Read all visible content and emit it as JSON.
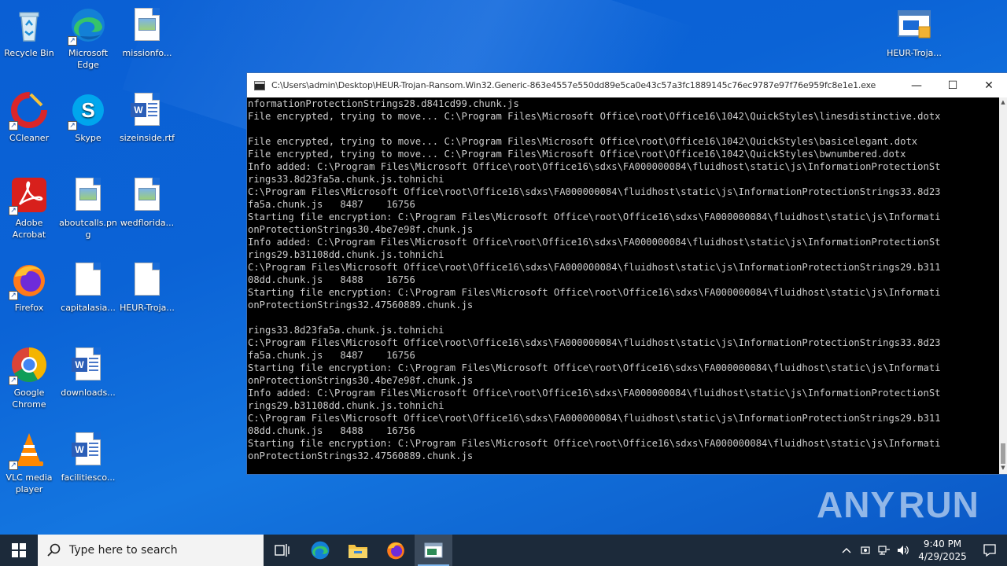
{
  "desktop": {
    "icons": [
      {
        "label": "Recycle Bin",
        "icon": "recycle-bin-icon"
      },
      {
        "label": "Microsoft Edge",
        "icon": "edge-icon"
      },
      {
        "label": "missionfo...",
        "icon": "image-file-icon"
      },
      {
        "label": "CCleaner",
        "icon": "ccleaner-icon"
      },
      {
        "label": "Skype",
        "icon": "skype-icon"
      },
      {
        "label": "sizeinside.rtf",
        "icon": "word-document-icon"
      },
      {
        "label": "Adobe Acrobat",
        "icon": "acrobat-icon"
      },
      {
        "label": "aboutcalls.png",
        "icon": "image-file-icon"
      },
      {
        "label": "wedflorida...",
        "icon": "image-file-icon"
      },
      {
        "label": "Firefox",
        "icon": "firefox-icon"
      },
      {
        "label": "capitalasia...",
        "icon": "blank-file-icon"
      },
      {
        "label": "HEUR-Troja...",
        "icon": "blank-file-icon"
      },
      {
        "label": "Google Chrome",
        "icon": "chrome-icon"
      },
      {
        "label": "downloads...",
        "icon": "word-document-icon"
      },
      {
        "label": "VLC media player",
        "icon": "vlc-icon"
      },
      {
        "label": "facilitiesco...",
        "icon": "word-document-icon"
      },
      {
        "label": "HEUR-Troja...",
        "icon": "executable-icon"
      }
    ]
  },
  "console_window": {
    "title": "C:\\Users\\admin\\Desktop\\HEUR-Trojan-Ransom.Win32.Generic-863e4557e550dd89e5ca0e43c57a3fc1889145c76ec9787e97f76e959fc8e1e1.exe",
    "minimize_glyph": "—",
    "maximize_glyph": "☐",
    "close_glyph": "✕",
    "lines": [
      "nformationProtectionStrings28.d841cd99.chunk.js",
      "File encrypted, trying to move... C:\\Program Files\\Microsoft Office\\root\\Office16\\1042\\QuickStyles\\linesdistinctive.dotx",
      "",
      "File encrypted, trying to move... C:\\Program Files\\Microsoft Office\\root\\Office16\\1042\\QuickStyles\\basicelegant.dotx",
      "File encrypted, trying to move... C:\\Program Files\\Microsoft Office\\root\\Office16\\1042\\QuickStyles\\bwnumbered.dotx",
      "Info added: C:\\Program Files\\Microsoft Office\\root\\Office16\\sdxs\\FA000000084\\fluidhost\\static\\js\\InformationProtectionSt",
      "rings33.8d23fa5a.chunk.js.tohnichi",
      "C:\\Program Files\\Microsoft Office\\root\\Office16\\sdxs\\FA000000084\\fluidhost\\static\\js\\InformationProtectionStrings33.8d23",
      "fa5a.chunk.js   8487    16756",
      "Starting file encryption: C:\\Program Files\\Microsoft Office\\root\\Office16\\sdxs\\FA000000084\\fluidhost\\static\\js\\Informati",
      "onProtectionStrings30.4be7e98f.chunk.js",
      "Info added: C:\\Program Files\\Microsoft Office\\root\\Office16\\sdxs\\FA000000084\\fluidhost\\static\\js\\InformationProtectionSt",
      "rings29.b31108dd.chunk.js.tohnichi",
      "C:\\Program Files\\Microsoft Office\\root\\Office16\\sdxs\\FA000000084\\fluidhost\\static\\js\\InformationProtectionStrings29.b311",
      "08dd.chunk.js   8488    16756",
      "Starting file encryption: C:\\Program Files\\Microsoft Office\\root\\Office16\\sdxs\\FA000000084\\fluidhost\\static\\js\\Informati",
      "onProtectionStrings32.47560889.chunk.js",
      "",
      "rings33.8d23fa5a.chunk.js.tohnichi",
      "C:\\Program Files\\Microsoft Office\\root\\Office16\\sdxs\\FA000000084\\fluidhost\\static\\js\\InformationProtectionStrings33.8d23",
      "fa5a.chunk.js   8487    16756",
      "Starting file encryption: C:\\Program Files\\Microsoft Office\\root\\Office16\\sdxs\\FA000000084\\fluidhost\\static\\js\\Informati",
      "onProtectionStrings30.4be7e98f.chunk.js",
      "Info added: C:\\Program Files\\Microsoft Office\\root\\Office16\\sdxs\\FA000000084\\fluidhost\\static\\js\\InformationProtectionSt",
      "rings29.b31108dd.chunk.js.tohnichi",
      "C:\\Program Files\\Microsoft Office\\root\\Office16\\sdxs\\FA000000084\\fluidhost\\static\\js\\InformationProtectionStrings29.b311",
      "08dd.chunk.js   8488    16756",
      "Starting file encryption: C:\\Program Files\\Microsoft Office\\root\\Office16\\sdxs\\FA000000084\\fluidhost\\static\\js\\Informati",
      "onProtectionStrings32.47560889.chunk.js"
    ]
  },
  "watermark": {
    "left": "ANY",
    "right": "RUN"
  },
  "taskbar": {
    "search_placeholder": "Type here to search",
    "pinned": [
      "task-view-icon",
      "edge-icon",
      "file-explorer-icon",
      "firefox-icon",
      "console-app-icon"
    ],
    "clock_time": "9:40 PM",
    "clock_date": "4/29/2025"
  },
  "colors": {
    "desktop_bg": "#0b63d6",
    "taskbar_bg": "#1c2a3a",
    "console_bg": "#000000",
    "console_text": "#cccccc"
  }
}
